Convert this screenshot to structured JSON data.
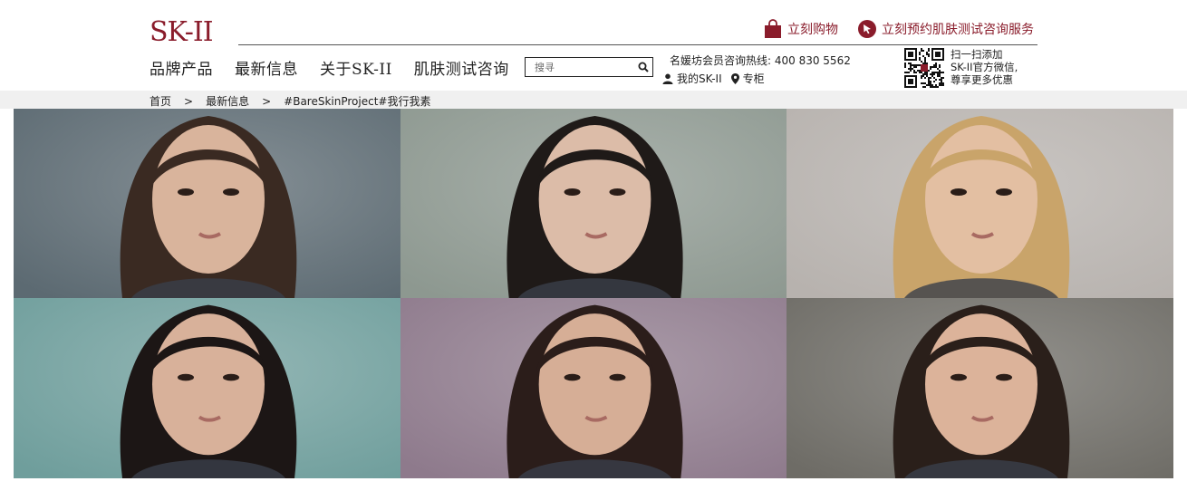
{
  "brand": {
    "logo_text": "SK-II"
  },
  "top_links": {
    "shop_label": "立刻购物",
    "appointment_label": "立刻预约肌肤测试咨询服务"
  },
  "nav": [
    {
      "label": "品牌产品"
    },
    {
      "label": "最新信息"
    },
    {
      "label": "关于SK-II"
    },
    {
      "label": "肌肤测试咨询"
    }
  ],
  "search": {
    "placeholder": "搜寻"
  },
  "hotline": {
    "text": "名媛坊会员咨询热线: 400 830 5562"
  },
  "account": {
    "my_label": "我的SK-II",
    "counter_label": "专柜"
  },
  "qr_promo": {
    "line1": "扫一扫添加",
    "line2": "SK-II官方微信,",
    "line3": "尊享更多优惠"
  },
  "breadcrumbs": {
    "home": "首页",
    "news": "最新信息",
    "current": "#BareSkinProject#我行我素",
    "separator": ">"
  },
  "colors": {
    "brand_red": "#8a1c2b",
    "crumb_bg": "#f0f0f0"
  },
  "gallery": [
    {
      "bg": "#5c6a72",
      "hair": "#3a2a22",
      "skin": "#d9b49c"
    },
    {
      "bg": "#8d9890",
      "hair": "#1f1a18",
      "skin": "#dcbca8"
    },
    {
      "bg": "#b7b2ae",
      "hair": "#c9a46a",
      "skin": "#e3bfa2"
    },
    {
      "bg": "#6f9e9c",
      "hair": "#1c1615",
      "skin": "#d8b19a"
    },
    {
      "bg": "#8e7a8c",
      "hair": "#2b1d1a",
      "skin": "#d6ae96"
    },
    {
      "bg": "#6e6c66",
      "hair": "#2a1f1a",
      "skin": "#dcb39a"
    }
  ]
}
